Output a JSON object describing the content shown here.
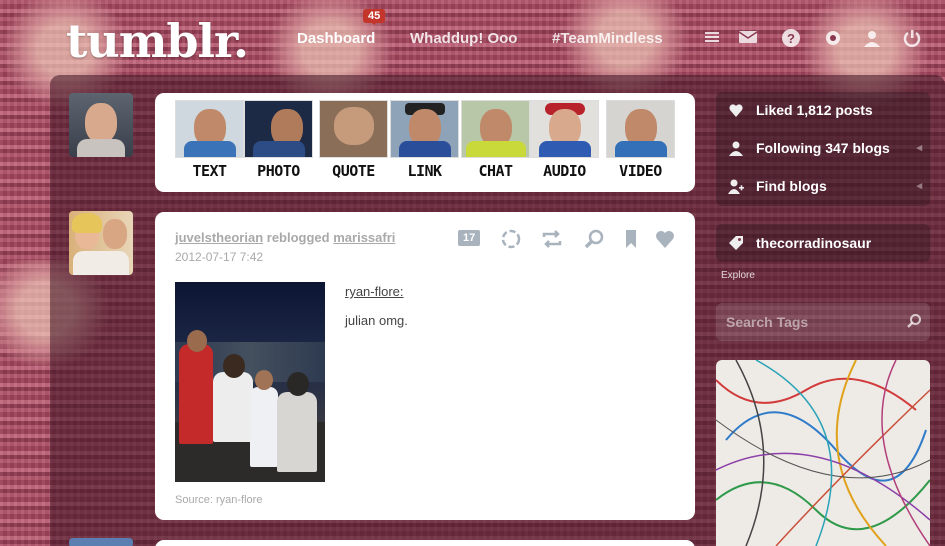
{
  "header": {
    "logo": "tumblr.",
    "nav": [
      {
        "label": "Dashboard",
        "active": true
      },
      {
        "label": "Whaddup! Ooo",
        "active": false
      },
      {
        "label": "#TeamMindless",
        "active": false
      }
    ],
    "badge": "45",
    "icons": [
      "menu-icon",
      "mail-icon",
      "help-icon",
      "settings-icon",
      "profile-icon",
      "power-icon"
    ]
  },
  "post_types": [
    {
      "label": "TEXT",
      "color": "#3b73b8"
    },
    {
      "label": "PHOTO",
      "color": "#2d4c86"
    },
    {
      "label": "QUOTE",
      "color": "#3a2b1e"
    },
    {
      "label": "LINK",
      "color": "#2b4e9a"
    },
    {
      "label": "CHAT",
      "color": "#c9d93a"
    },
    {
      "label": "AUDIO",
      "color": "#2f5bb2"
    },
    {
      "label": "VIDEO",
      "color": "#3470b7"
    }
  ],
  "post": {
    "author": "juvelstheorian",
    "action": "reblogged",
    "reblogged_from": "marissafri",
    "date": "2012-07-17 7:42",
    "note_count": "17",
    "quote_source": "ryan-flore:",
    "quote_text": "julian omg.",
    "source_label": "Source:",
    "source_value": "ryan-flore"
  },
  "sidebar": {
    "liked": "Liked 1,812 posts",
    "following": "Following 347 blogs",
    "find": "Find blogs",
    "blog": "thecorradinosaur",
    "explore": "Explore",
    "search_placeholder": "Search Tags"
  }
}
